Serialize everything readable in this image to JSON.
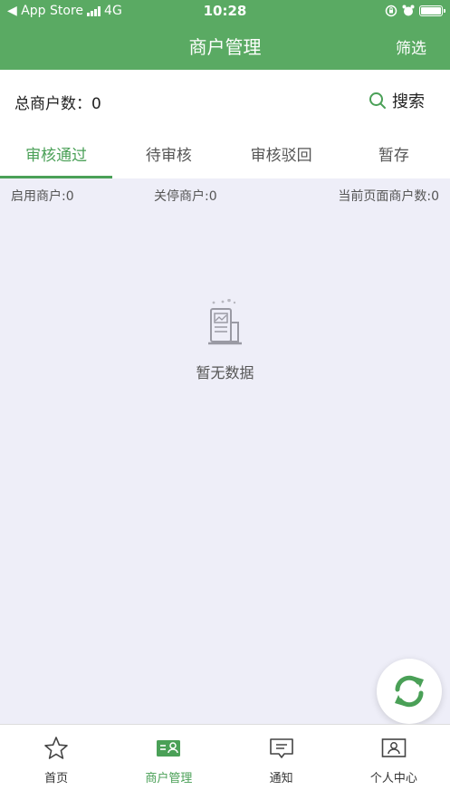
{
  "status_bar": {
    "back_app": "◀ App Store",
    "network": "4G",
    "time": "10:28"
  },
  "nav": {
    "title": "商户管理",
    "filter_label": "筛选"
  },
  "summary": {
    "total_label": "总商户数：0",
    "search_label": "搜索"
  },
  "tabs": [
    {
      "label": "审核通过",
      "active": true
    },
    {
      "label": "待审核",
      "active": false
    },
    {
      "label": "审核驳回",
      "active": false
    },
    {
      "label": "暂存",
      "active": false
    }
  ],
  "stats": {
    "enabled": "启用商户:0",
    "stopped": "关停商户:0",
    "page_count": "当前页面商户数:0"
  },
  "empty_state": {
    "text": "暂无数据",
    "icon": "empty-document-icon"
  },
  "tabbar": [
    {
      "label": "首页",
      "icon": "star-icon",
      "active": false
    },
    {
      "label": "商户管理",
      "icon": "merchant-card-icon",
      "active": true
    },
    {
      "label": "通知",
      "icon": "message-icon",
      "active": false
    },
    {
      "label": "个人中心",
      "icon": "profile-card-icon",
      "active": false
    }
  ],
  "colors": {
    "primary": "#5aaa63",
    "accent": "#4aa057",
    "background": "#eeeef8"
  }
}
